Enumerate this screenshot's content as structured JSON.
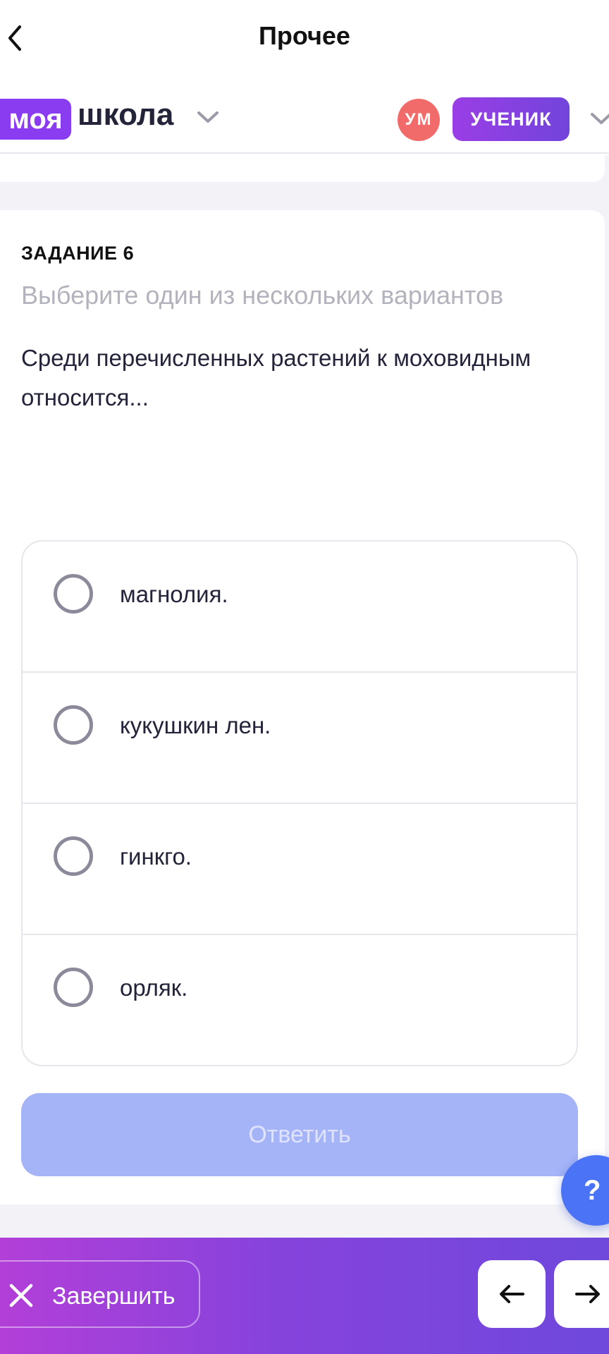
{
  "nav": {
    "title": "Прочее",
    "back_icon": "chevron-left-icon"
  },
  "header": {
    "logo_highlight": "моя",
    "logo_text": "школа",
    "avatar_initials": "УМ",
    "role": "УЧЕНИК"
  },
  "task": {
    "label": "ЗАДАНИЕ 6",
    "hint": "Выберите один из нескольких вариантов",
    "question": "Среди перечисленных растений к моховидным относится...",
    "options": [
      {
        "label": "магнолия."
      },
      {
        "label": "кукушкин лен."
      },
      {
        "label": "гинкго."
      },
      {
        "label": "орляк."
      }
    ],
    "answer_label": "Ответить"
  },
  "help": {
    "label": "?"
  },
  "bottom": {
    "finish_label": "Завершить"
  },
  "colors": {
    "brand": "#8a3cf0",
    "avatar": "#f26b6b",
    "answer_disabled": "#a5b4f7",
    "help": "#4a74f5"
  }
}
